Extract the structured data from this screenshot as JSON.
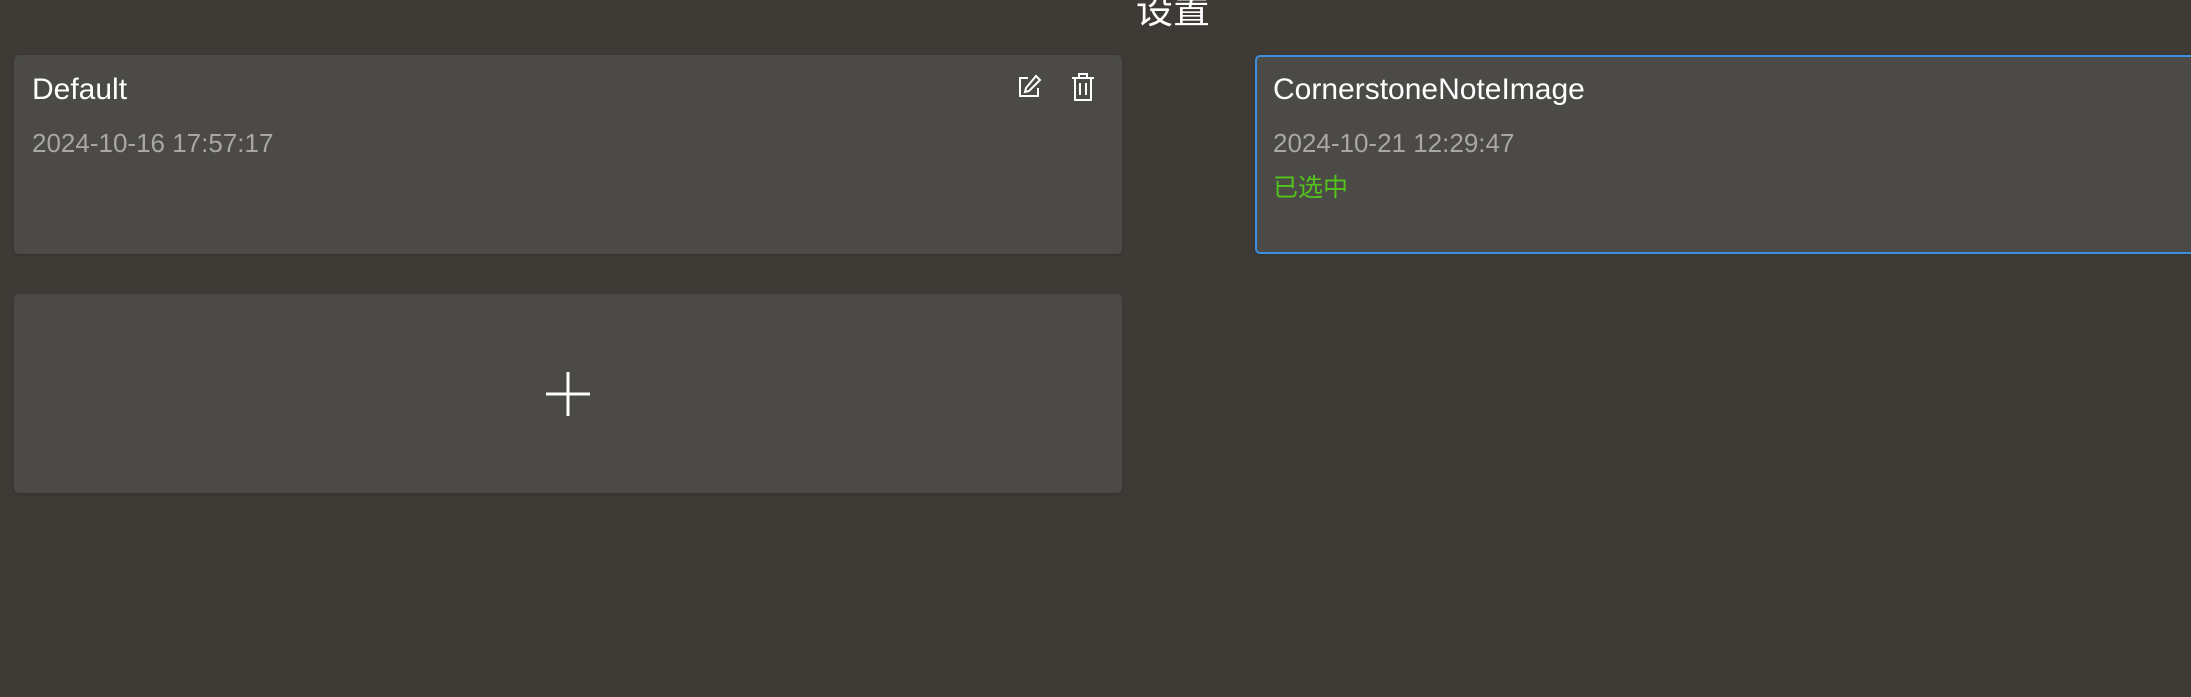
{
  "page": {
    "title": "设置"
  },
  "configs": [
    {
      "name": "Default",
      "date": "2024-10-16 17:57:17",
      "actions": {
        "edit_icon": "edit-icon",
        "delete_icon": "trash-icon"
      }
    },
    {
      "name": "CornerstoneNoteImage",
      "date": "2024-10-21 12:29:47",
      "status": "已选中",
      "selected": true
    }
  ],
  "add_card": {
    "icon": "plus-icon"
  },
  "colors": {
    "background": "#3e3a36",
    "card": "#4b4a47",
    "selected_border": "#3d8fe0",
    "selected_text": "#52c41a",
    "muted_text": "#a9a7a3"
  }
}
